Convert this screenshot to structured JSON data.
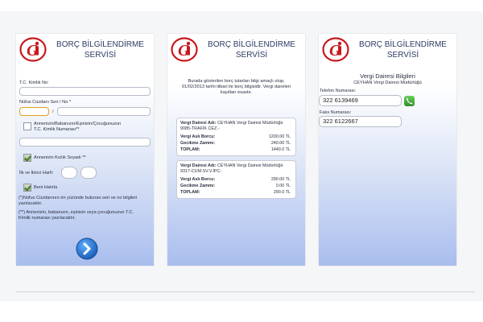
{
  "screens": {
    "login": {
      "title_line1": "BORÇ BİLGİLENDİRME",
      "title_line2": "SERVİSİ",
      "tc_label": "T.C. Kimlik No:",
      "tc_value": "",
      "nufus_label": "Nüfus Cüzdanı Seri / No *",
      "nufus_sep": "/",
      "parent_checkbox_label_1": "Annenizin/Babanızın/Eşinizin/Çocuğunuzun",
      "parent_checkbox_label_2": "T.C. Kimlik Numarası**",
      "maiden_checkbox_label": "Annenizin Kızlık Soyadı **",
      "initials_label": "İlk ve İkinci Harfi:",
      "remember_label": "Beni Hatırla",
      "note_1a": "(*)Nüfus Cüzdanının ön yüzünde bulunan seri ve no bilgileri",
      "note_1b": "yazılacaktır.",
      "note_2a": "(**) Annenizin, babanızın, eşinizin veya çocuğunuzun T.C.",
      "note_2b": "Kimlik numarası yazılacaktır."
    },
    "debts": {
      "title_line1": "BORÇ BİLGİLENDİRME",
      "title_line2": "SERVİSİ",
      "intro_1": "Burada gösterilen borç tutarları bilgi amaçlı olup,",
      "intro_2": "01/02/2013 tarihi itibari ile borç bilgisidir. Vergi daireleri",
      "intro_3": "kayıtları esastır.",
      "cards": [
        {
          "office_label": "Vergi Dairesi Adı:",
          "office_name": "CEYHAN Vergi Dairesi Müdürlüğü",
          "code": "9085-TRAFİK CEZ.-",
          "principal_label": "Vergi Aslı Borcu:",
          "principal": "1200.00 TL",
          "penalty_label": "Gecikme Zammı:",
          "penalty": "240.00 TL",
          "total_label": "TOPLAM:",
          "total": "1440.0 TL"
        },
        {
          "office_label": "Vergi Dairesi Adı:",
          "office_name": "CEYHAN Vergi Dairesi Müdürlüğü",
          "code": "9317-CUM.SV.V.İPC-",
          "principal_label": "Vergi Aslı Borcu:",
          "principal": "290.00 TL",
          "penalty_label": "Gecikme Zammı:",
          "penalty": "0.00 TL",
          "total_label": "TOPLAM:",
          "total": "290.0 TL"
        }
      ]
    },
    "office": {
      "title_line1": "BORÇ BİLGİLENDİRME",
      "title_line2": "SERVİSİ",
      "section_title": "Vergi Dairesi Bilgileri",
      "office_name": "CEYHAN Vergi Dairesi Müdürlüğü",
      "phone_label": "Telefon Numarası:",
      "phone": "322 6139469",
      "fax_label": "Faks Numarası:",
      "fax": "322 6122667"
    }
  },
  "colors": {
    "title": "#2c3c64",
    "logo_red": "#c8191e",
    "next_button": "#2a7fd6",
    "call_green": "#3ea53b"
  },
  "icons": {
    "logo": "gi-logo-icon",
    "next": "chevron-right-icon",
    "call": "phone-icon"
  }
}
